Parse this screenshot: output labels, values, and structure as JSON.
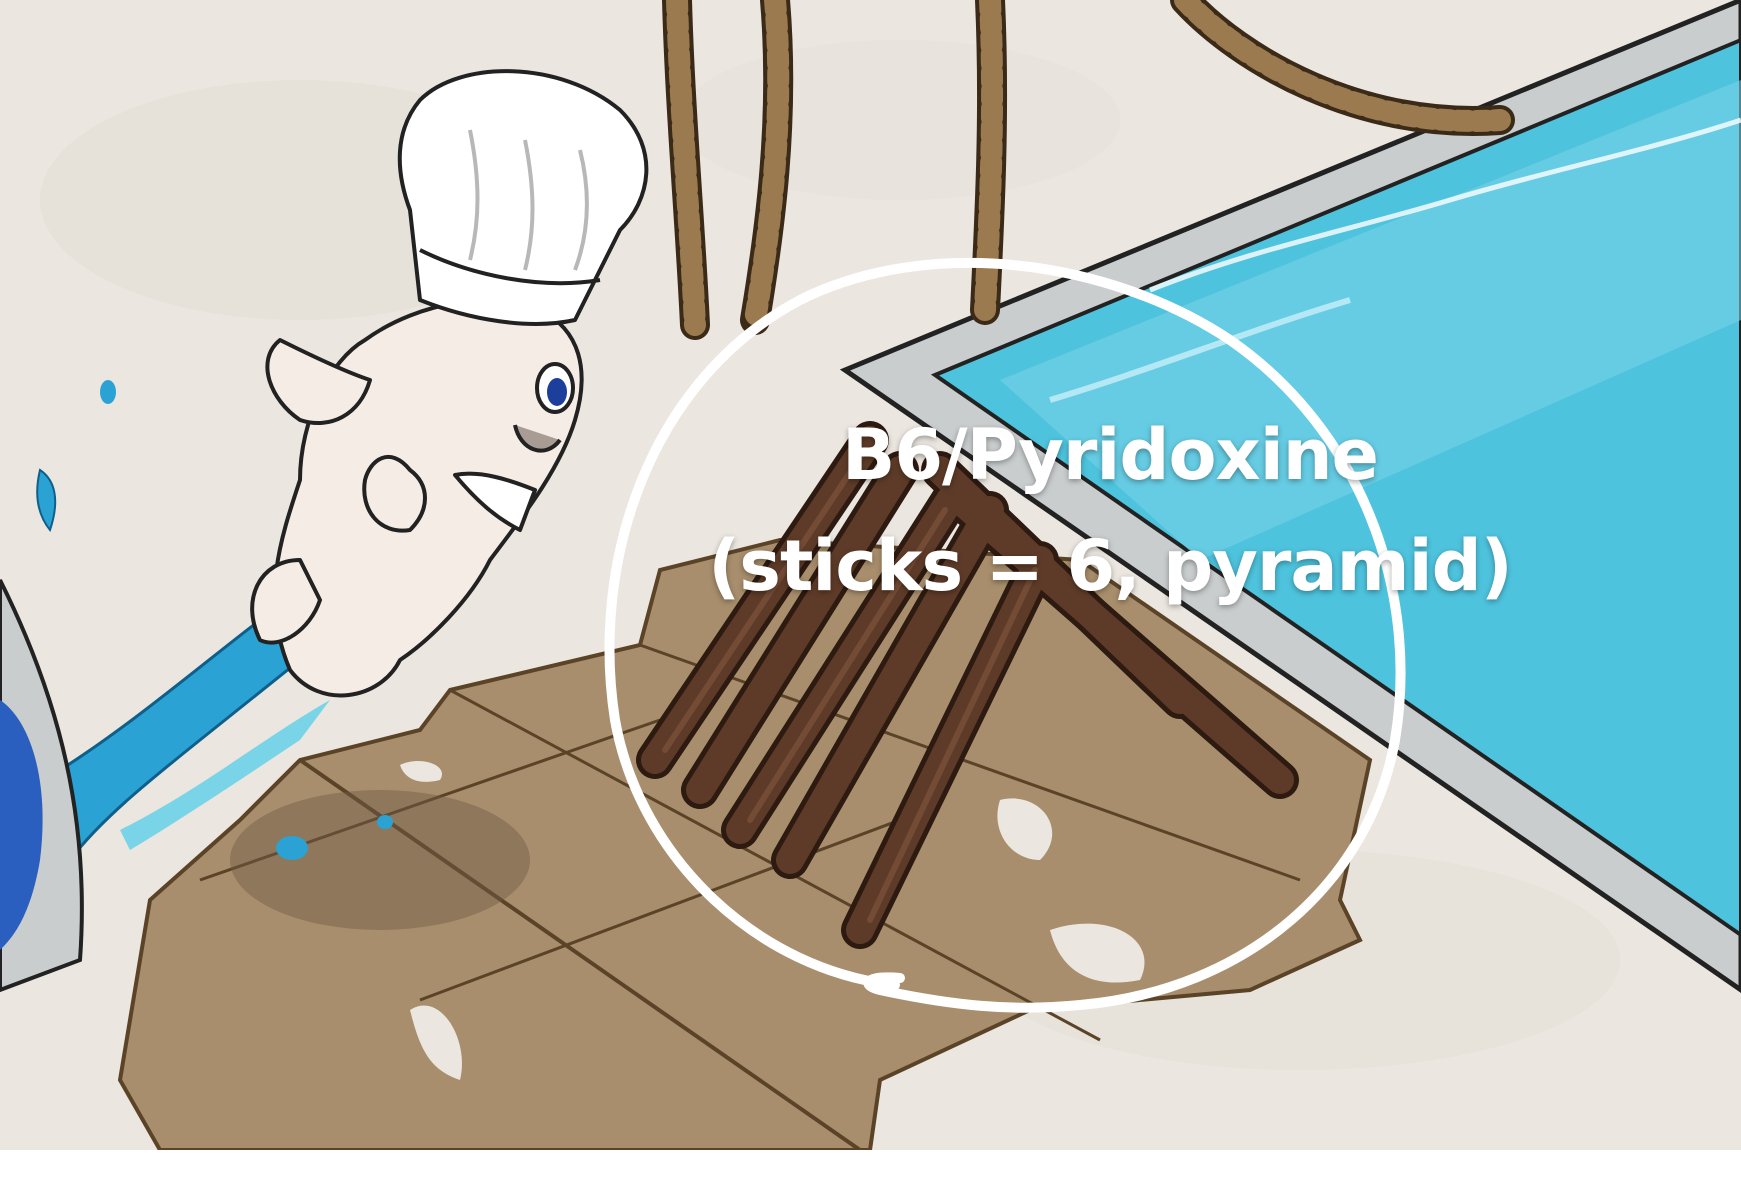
{
  "caption": {
    "line1": "B6/Pyridoxine",
    "line2": "(sticks = 6, pyramid)"
  },
  "colors": {
    "background_paper": "#ebe6df",
    "pool_water": "#4ec3dd",
    "pool_rim": "#c9cdce",
    "wood_floor": "#a88e6c",
    "sticks": "#5e3b28",
    "rope": "#9a7a4e",
    "doughboy": "#f6ece6",
    "circle": "#ffffff",
    "splash": "#2aa3d4",
    "mop_head": "#2b5fbf"
  },
  "icons": {
    "character": "doughboy-chef-illustration",
    "stick_pile": "stick-pyramid-illustration",
    "pool": "swimming-pool-illustration",
    "ropes": "hanging-rope-illustration",
    "highlight": "hand-drawn-circle-highlight"
  }
}
